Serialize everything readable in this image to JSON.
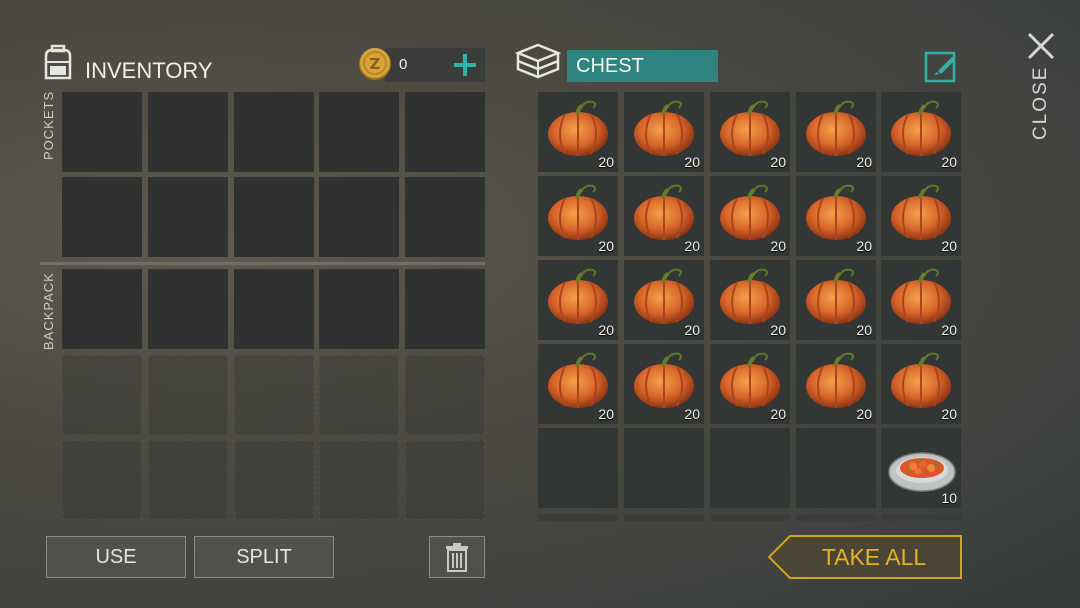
{
  "inventory": {
    "title": "INVENTORY",
    "icon": "backpack-icon",
    "coins": "0",
    "add_icon": "plus-icon",
    "pockets_label": "POCKETS",
    "backpack_label": "BACKPACK"
  },
  "chest": {
    "title": "CHEST",
    "icon": "chest-icon",
    "edit_icon": "edit-icon",
    "slots": [
      {
        "item": "pumpkin",
        "count": "20"
      },
      {
        "item": "pumpkin",
        "count": "20"
      },
      {
        "item": "pumpkin",
        "count": "20"
      },
      {
        "item": "pumpkin",
        "count": "20"
      },
      {
        "item": "pumpkin",
        "count": "20"
      },
      {
        "item": "pumpkin",
        "count": "20"
      },
      {
        "item": "pumpkin",
        "count": "20"
      },
      {
        "item": "pumpkin",
        "count": "20"
      },
      {
        "item": "pumpkin",
        "count": "20"
      },
      {
        "item": "pumpkin",
        "count": "20"
      },
      {
        "item": "pumpkin",
        "count": "20"
      },
      {
        "item": "pumpkin",
        "count": "20"
      },
      {
        "item": "pumpkin",
        "count": "20"
      },
      {
        "item": "pumpkin",
        "count": "20"
      },
      {
        "item": "pumpkin",
        "count": "20"
      },
      {
        "item": "pumpkin",
        "count": "20"
      },
      {
        "item": "pumpkin",
        "count": "20"
      },
      {
        "item": "pumpkin",
        "count": "20"
      },
      {
        "item": "pumpkin",
        "count": "20"
      },
      {
        "item": "pumpkin",
        "count": "20"
      },
      {
        "item": "",
        "count": ""
      },
      {
        "item": "",
        "count": ""
      },
      {
        "item": "",
        "count": ""
      },
      {
        "item": "",
        "count": ""
      },
      {
        "item": "food-plate",
        "count": "10"
      }
    ]
  },
  "buttons": {
    "use": "USE",
    "split": "SPLIT",
    "trash_icon": "trash-icon",
    "take_all": "TAKE ALL"
  },
  "close": {
    "label": "CLOSE",
    "icon": "close-icon"
  },
  "colors": {
    "accent_teal": "#2f8f8c",
    "take_all_gold": "#d4a41e",
    "coin_gold": "#c9962b"
  }
}
